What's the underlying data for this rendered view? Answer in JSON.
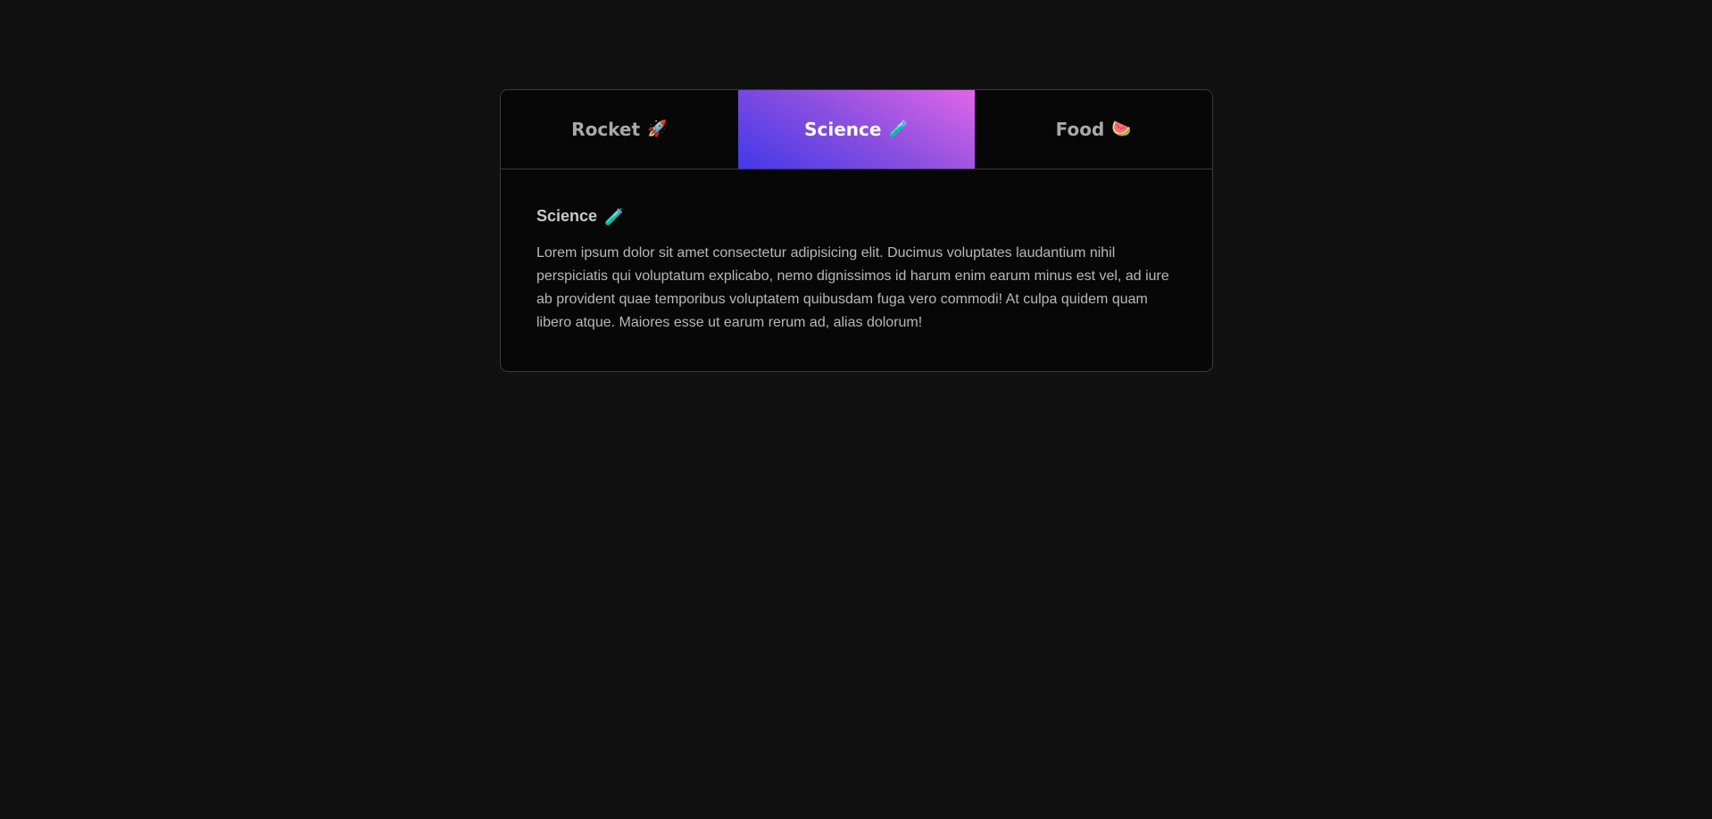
{
  "tabs": [
    {
      "label": "Rocket",
      "emoji": "🚀",
      "icon": "rocket-icon",
      "active": false
    },
    {
      "label": "Science",
      "emoji": "🧪",
      "icon": "test-tube-icon",
      "active": true
    },
    {
      "label": "Food",
      "emoji": "🍉",
      "icon": "watermelon-icon",
      "active": false
    }
  ],
  "panel": {
    "title": "Science",
    "emoji": "🧪",
    "text": "Lorem ipsum dolor sit amet consectetur adipisicing elit. Ducimus voluptates laudantium nihil perspiciatis qui voluptatum explicabo, nemo dignissimos id harum enim earum minus est vel, ad iure ab provident quae temporibus voluptatem quibusdam fuga vero commodi! At culpa quidem quam libero atque. Maiores esse ut earum rerum ad, alias dolorum!"
  },
  "colors": {
    "background": "#111111",
    "card": "#070707",
    "active_gradient_start": "#4338e8",
    "active_gradient_end": "#e166e8"
  }
}
